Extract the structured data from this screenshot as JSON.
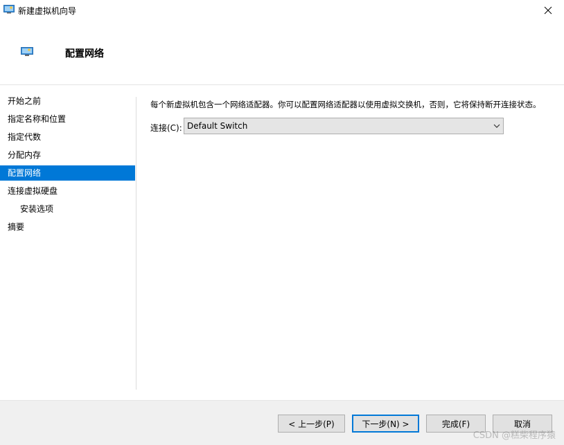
{
  "window": {
    "title": "新建虚拟机向导"
  },
  "header": {
    "title": "配置网络"
  },
  "sidebar": {
    "items": [
      {
        "label": "开始之前"
      },
      {
        "label": "指定名称和位置"
      },
      {
        "label": "指定代数"
      },
      {
        "label": "分配内存"
      },
      {
        "label": "配置网络",
        "active": true
      },
      {
        "label": "连接虚拟硬盘"
      },
      {
        "label": "安装选项",
        "sub": true
      },
      {
        "label": "摘要"
      }
    ]
  },
  "main": {
    "description": "每个新虚拟机包含一个网络适配器。你可以配置网络适配器以使用虚拟交换机，否则，它将保持断开连接状态。",
    "connection_label": "连接(C):",
    "connection_value": "Default Switch"
  },
  "footer": {
    "previous_label": "< 上一步(P)",
    "next_label": "下一步(N) >",
    "finish_label": "完成(F)",
    "cancel_label": "取消"
  },
  "watermark": "CSDN @糕柴程序猿",
  "colors": {
    "accent": "#0078d7"
  }
}
